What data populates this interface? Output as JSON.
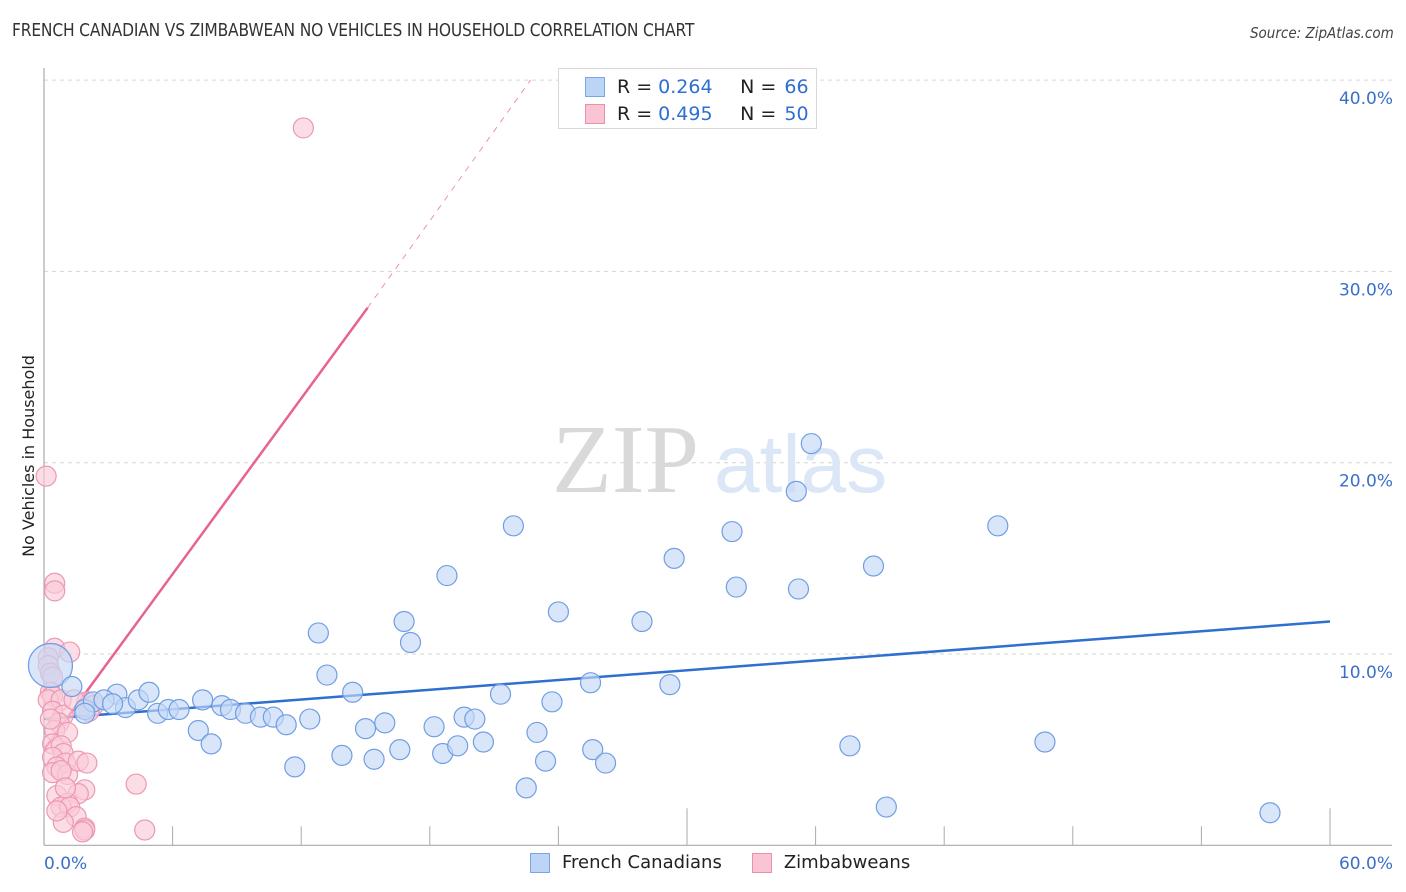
{
  "header": {
    "title": "FRENCH CANADIAN VS ZIMBABWEAN NO VEHICLES IN HOUSEHOLD CORRELATION CHART",
    "source": "Source: ZipAtlas.com"
  },
  "watermark": {
    "zip": "ZIP",
    "atlas": "atlas"
  },
  "legend_top": {
    "rows": [
      {
        "r_label": "R = ",
        "r_value": "0.264",
        "n_label": "N = ",
        "n_value": "66",
        "color_fill": "#bcd4f6",
        "color_stroke": "#7aa5e6"
      },
      {
        "r_label": "R = ",
        "r_value": "0.495",
        "n_label": "N = ",
        "n_value": "50",
        "color_fill": "#f9c4d4",
        "color_stroke": "#ec8fac"
      }
    ]
  },
  "legend_bottom": {
    "items": [
      {
        "label": "French Canadians",
        "color_fill": "#bcd4f6",
        "color_stroke": "#7aa5e6"
      },
      {
        "label": "Zimbabweans",
        "color_fill": "#f9c4d4",
        "color_stroke": "#ec8fac"
      }
    ]
  },
  "chart_data": {
    "type": "scatter",
    "title": "FRENCH CANADIAN VS ZIMBABWEAN NO VEHICLES IN HOUSEHOLD CORRELATION CHART",
    "xlabel": "",
    "ylabel": "No Vehicles in Household",
    "xlim": [
      0,
      60
    ],
    "ylim": [
      0,
      42
    ],
    "x_tick_labels": [
      {
        "value": 0,
        "label": "0.0%"
      },
      {
        "value": 60,
        "label": "60.0%"
      }
    ],
    "x_minor_ticks": [
      6,
      12,
      18,
      24,
      30,
      36,
      42,
      48,
      54,
      60
    ],
    "y_tick_labels": [
      {
        "value": 10,
        "label": "10.0%"
      },
      {
        "value": 20,
        "label": "20.0%"
      },
      {
        "value": 30,
        "label": "30.0%"
      },
      {
        "value": 40,
        "label": "40.0%"
      }
    ],
    "grid": true,
    "legend_position": "top-center",
    "series": [
      {
        "name": "French Canadians",
        "color": "#2f6fd0",
        "fill": "#c5d9f6",
        "stroke": "#6f9ee3",
        "R": 0.264,
        "N": 66,
        "trend": {
          "x": [
            0,
            60
          ],
          "y": [
            6.6,
            11.7
          ],
          "style": "solid"
        },
        "points": [
          [
            0.3,
            9.4
          ],
          [
            1.3,
            8.3
          ],
          [
            1.9,
            7.1
          ],
          [
            2.3,
            7.5
          ],
          [
            3.4,
            7.9
          ],
          [
            2.8,
            7.6
          ],
          [
            3.8,
            7.2
          ],
          [
            4.4,
            7.6
          ],
          [
            4.9,
            8.0
          ],
          [
            5.3,
            6.9
          ],
          [
            5.8,
            7.1
          ],
          [
            6.3,
            7.1
          ],
          [
            7.2,
            6.0
          ],
          [
            7.4,
            7.6
          ],
          [
            7.8,
            5.3
          ],
          [
            8.3,
            7.3
          ],
          [
            8.7,
            7.1
          ],
          [
            9.4,
            6.9
          ],
          [
            10.1,
            6.7
          ],
          [
            10.7,
            6.7
          ],
          [
            11.3,
            6.3
          ],
          [
            11.7,
            4.1
          ],
          [
            12.4,
            6.6
          ],
          [
            12.8,
            11.1
          ],
          [
            13.2,
            8.9
          ],
          [
            13.9,
            4.7
          ],
          [
            14.4,
            8.0
          ],
          [
            15.0,
            6.1
          ],
          [
            15.4,
            4.5
          ],
          [
            15.9,
            6.4
          ],
          [
            16.6,
            5.0
          ],
          [
            16.8,
            11.7
          ],
          [
            17.1,
            10.6
          ],
          [
            18.2,
            6.2
          ],
          [
            18.6,
            4.8
          ],
          [
            18.8,
            14.1
          ],
          [
            19.3,
            5.2
          ],
          [
            19.6,
            6.7
          ],
          [
            20.1,
            6.6
          ],
          [
            20.5,
            5.4
          ],
          [
            21.3,
            7.9
          ],
          [
            21.9,
            16.7
          ],
          [
            22.5,
            3.0
          ],
          [
            23.0,
            5.9
          ],
          [
            23.4,
            4.4
          ],
          [
            23.7,
            7.5
          ],
          [
            24.0,
            12.2
          ],
          [
            25.5,
            8.5
          ],
          [
            25.6,
            5.0
          ],
          [
            26.2,
            4.3
          ],
          [
            27.9,
            11.7
          ],
          [
            29.2,
            8.4
          ],
          [
            29.4,
            15.0
          ],
          [
            32.1,
            16.4
          ],
          [
            32.3,
            13.5
          ],
          [
            35.1,
            18.5
          ],
          [
            35.2,
            13.4
          ],
          [
            35.8,
            21.0
          ],
          [
            37.6,
            5.2
          ],
          [
            38.7,
            14.6
          ],
          [
            39.3,
            2.0
          ],
          [
            44.5,
            16.7
          ],
          [
            46.7,
            5.4
          ],
          [
            57.2,
            1.7
          ],
          [
            1.9,
            6.9
          ],
          [
            3.2,
            7.4
          ]
        ]
      },
      {
        "name": "Zimbabweans",
        "color": "#e8638f",
        "fill": "#f9cbd9",
        "stroke": "#ee97b2",
        "R": 0.495,
        "N": 50,
        "trend": {
          "x": [
            0,
            15.1
          ],
          "y": [
            5.0,
            28.1
          ],
          "style": "solid",
          "extension": {
            "x": [
              15.1,
              22.7
            ],
            "y": [
              28.1,
              40.0
            ],
            "style": "dashed"
          }
        },
        "points": [
          [
            0.1,
            19.3
          ],
          [
            0.5,
            13.7
          ],
          [
            0.5,
            13.3
          ],
          [
            0.5,
            10.3
          ],
          [
            1.2,
            10.1
          ],
          [
            0.2,
            9.8
          ],
          [
            0.2,
            9.4
          ],
          [
            0.3,
            9.0
          ],
          [
            0.4,
            8.8
          ],
          [
            0.3,
            8.0
          ],
          [
            0.4,
            7.8
          ],
          [
            0.2,
            7.6
          ],
          [
            0.8,
            7.6
          ],
          [
            0.4,
            7.0
          ],
          [
            0.9,
            6.8
          ],
          [
            0.7,
            6.4
          ],
          [
            0.5,
            6.0
          ],
          [
            1.1,
            5.9
          ],
          [
            0.4,
            5.3
          ],
          [
            0.8,
            5.2
          ],
          [
            0.9,
            4.8
          ],
          [
            0.4,
            4.6
          ],
          [
            1.0,
            4.3
          ],
          [
            0.6,
            4.1
          ],
          [
            0.4,
            3.8
          ],
          [
            1.1,
            3.7
          ],
          [
            0.8,
            3.9
          ],
          [
            1.6,
            4.4
          ],
          [
            2.0,
            4.3
          ],
          [
            1.9,
            2.9
          ],
          [
            1.6,
            2.7
          ],
          [
            0.6,
            2.6
          ],
          [
            1.1,
            2.2
          ],
          [
            0.8,
            2.0
          ],
          [
            1.2,
            2.0
          ],
          [
            1.5,
            1.5
          ],
          [
            0.9,
            1.2
          ],
          [
            1.9,
            0.9
          ],
          [
            1.9,
            0.8
          ],
          [
            1.8,
            0.7
          ],
          [
            4.3,
            3.2
          ],
          [
            4.7,
            0.8
          ],
          [
            12.1,
            37.5
          ],
          [
            2.0,
            7.5
          ],
          [
            1.4,
            7.6
          ],
          [
            2.3,
            7.3
          ],
          [
            2.1,
            7.0
          ],
          [
            0.3,
            6.6
          ],
          [
            1.0,
            3.0
          ],
          [
            0.6,
            1.8
          ]
        ]
      }
    ]
  }
}
